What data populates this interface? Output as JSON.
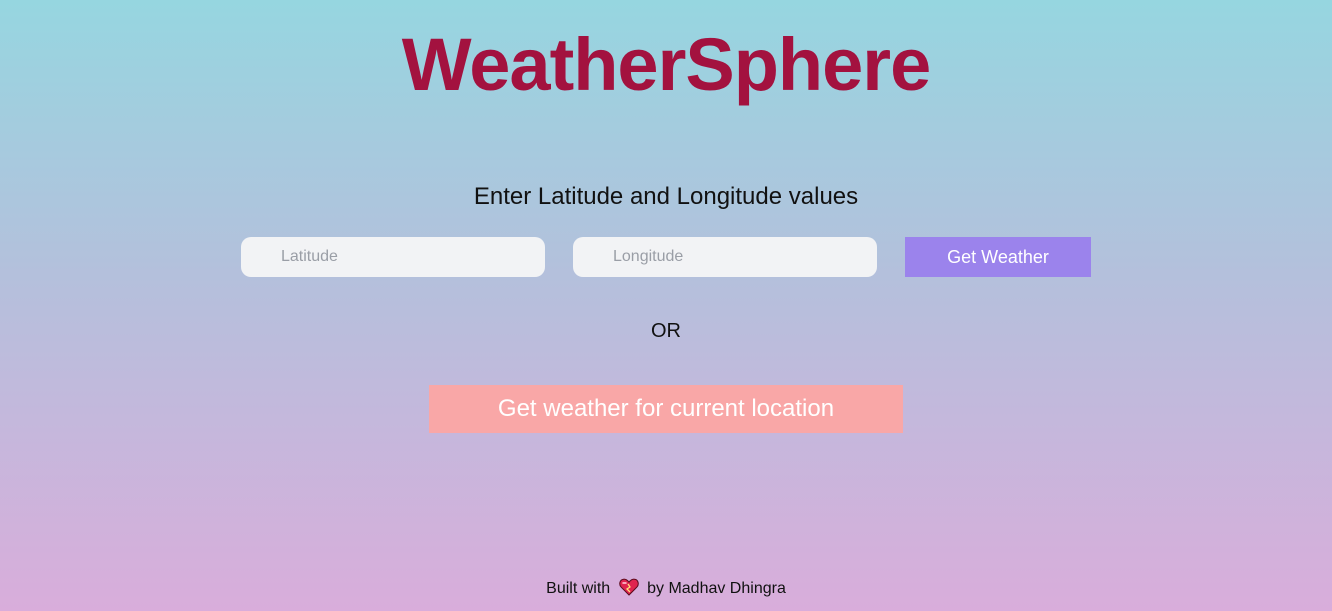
{
  "app": {
    "title": "WeatherSphere"
  },
  "form": {
    "prompt": "Enter Latitude and Longitude values",
    "latitude_placeholder": "Latitude",
    "latitude_value": "",
    "longitude_placeholder": "Longitude",
    "longitude_value": "",
    "get_weather_label": "Get Weather",
    "or_label": "OR",
    "current_location_label": "Get weather for current location"
  },
  "footer": {
    "prefix": "Built with",
    "icon": "heart-icon",
    "suffix": "by Madhav Dhingra"
  },
  "colors": {
    "title": "#a3123f",
    "get_weather_button": "#9b83ec",
    "current_location_button": "#f9a7a7",
    "input_background": "#f2f3f5"
  }
}
